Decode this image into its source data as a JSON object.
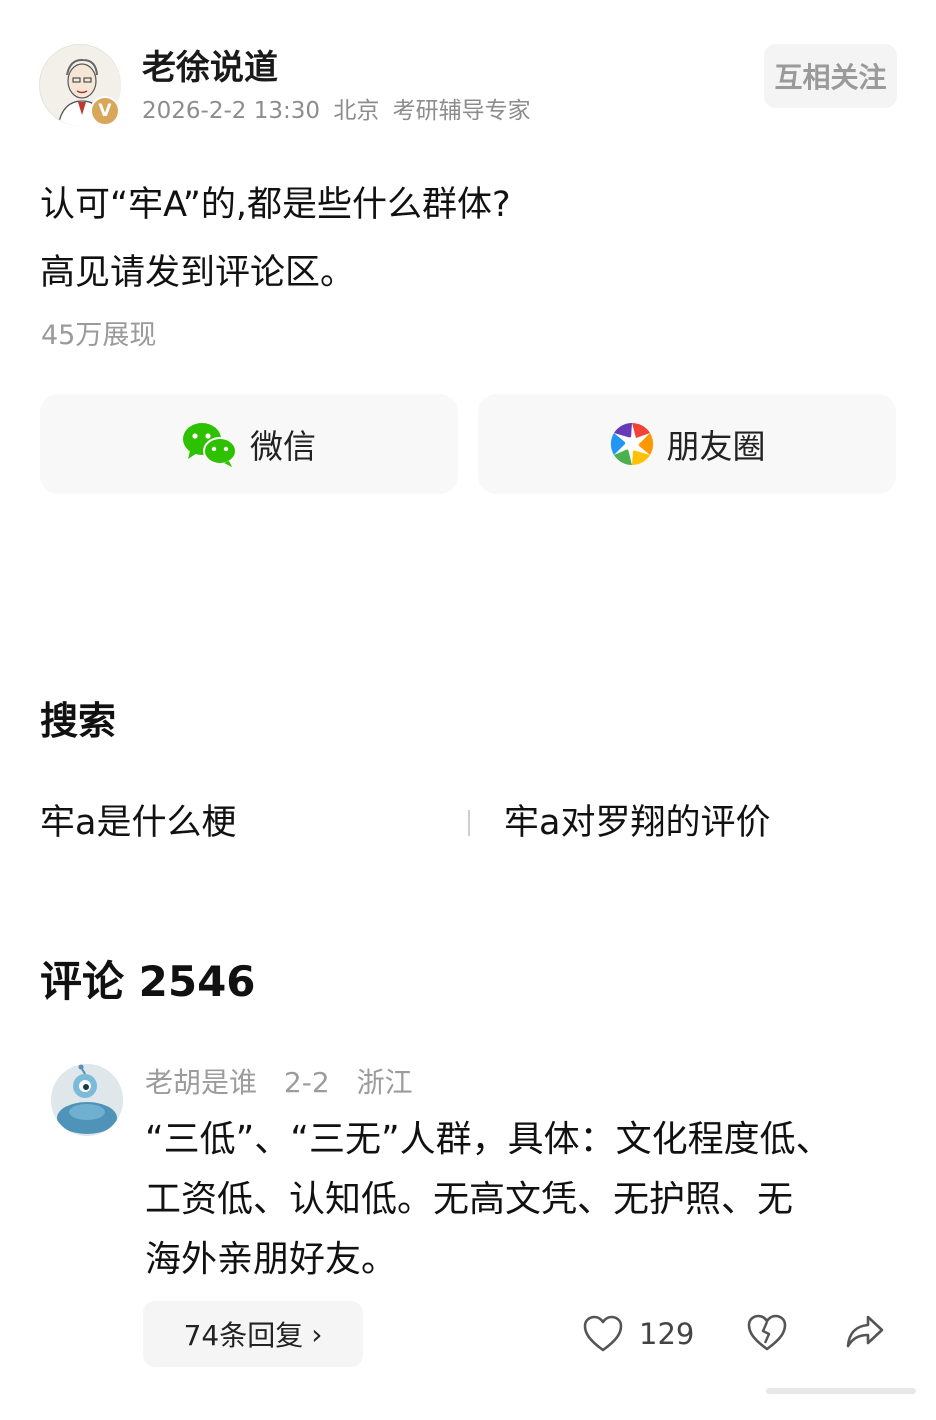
{
  "author": {
    "name": "老徐说道",
    "date": "2026-2-2 13:30",
    "location": "北京",
    "title": "考研辅导专家",
    "verified_badge": "V",
    "follow_label": "互相关注"
  },
  "post": {
    "line1": "认可“牢A”的,都是些什么群体?",
    "line2": "高见请发到评论区。",
    "views": "45万展现"
  },
  "share": {
    "wechat_label": "微信",
    "moments_label": "朋友圈",
    "wechat_icon": "wechat-icon",
    "moments_icon": "moments-aperture-icon"
  },
  "search": {
    "title": "搜索",
    "items": [
      "牢a是什么梗",
      "牢a对罗翔的评价"
    ]
  },
  "comments": {
    "title": "评论 2546",
    "items": [
      {
        "user": "老胡是谁",
        "date": "2-2",
        "location": "浙江",
        "lines": [
          "“三低”、“三无”人群，具体：文化程度低、",
          "工资低、认知低。无高文凭、无护照、无",
          "海外亲朋好友。"
        ],
        "replies_label": "74条回复",
        "likes": "129"
      }
    ]
  },
  "colors": {
    "wechat_green": "#2dc100",
    "badge_gold": "#d9a75a",
    "meta_gray": "#8c8c8c"
  }
}
